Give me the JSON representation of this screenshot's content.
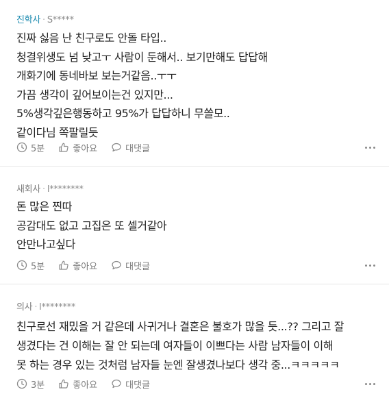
{
  "comments": [
    {
      "nickname": "진학사",
      "separator": "·",
      "user": "S*****",
      "lines": [
        "진짜 싫음 난 친구로도 안돌 타입..",
        "청결위생도 넘 낮고ㅜ 사람이 둔해서.. 보기만해도 답답해",
        "개화기에 동네바보 보는거같음..ㅜㅜ",
        "가끔 생각이 깊어보이는건 있지만...",
        "5%생각깊은행동하고 95%가 답답하니 무쓸모..",
        "같이다님 쪽팔릴듯"
      ],
      "time": "5분",
      "like_label": "좋아요",
      "reply_label": "대댓글"
    },
    {
      "nickname": "새회사",
      "separator": "·",
      "user": "l********",
      "lines": [
        "돈 많은 찐따",
        "공감대도 없고 고집은 또 셀거같아",
        "안만나고싶다"
      ],
      "time": "5분",
      "like_label": "좋아요",
      "reply_label": "대댓글"
    },
    {
      "nickname": "의사",
      "separator": "·",
      "user": "l********",
      "lines": [
        "친구로선 재밌을 거 같은데 사귀거나 결혼은 불호가 많을 듯...?? 그리고 잘",
        "생겼다는 건 이해는 잘 안 되는데 여자들이 이쁘다는 사람 남자들이 이해",
        "못 하는 경우 있는 것처럼 남자들 눈엔 잘생겼나보다 생각 중...ㅋㅋㅋㅋㅋ"
      ],
      "time": "3분",
      "like_label": "좋아요",
      "reply_label": "대댓글"
    }
  ],
  "colors": {
    "accent_nickname": "#1d8bb0",
    "meta_gray": "#7d7d7d",
    "text": "#222222",
    "divider": "#e6e6e6"
  },
  "icons": {
    "time": "clock-icon",
    "like": "thumbs-up-icon",
    "reply": "speech-bubble-icon",
    "more": "more-dots-icon"
  }
}
